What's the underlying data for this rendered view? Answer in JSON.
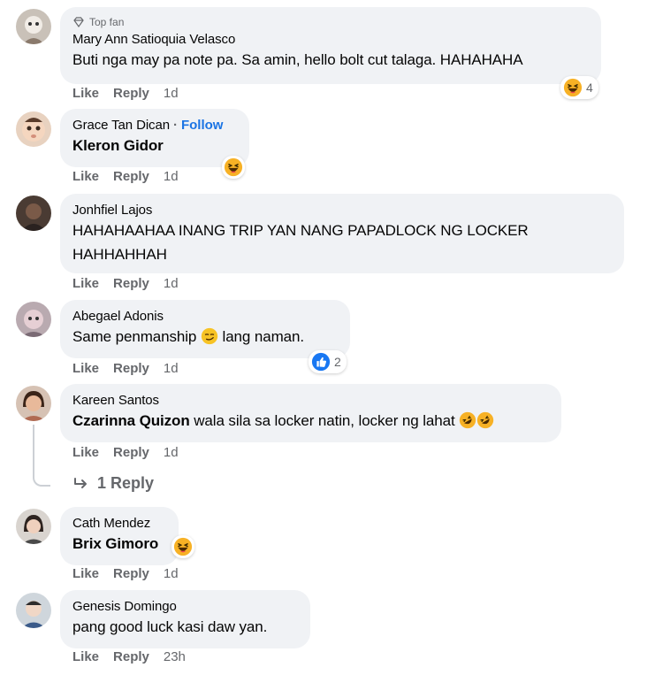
{
  "comments": [
    {
      "badge": "Top fan",
      "name": "Mary Ann Satioquia Velasco",
      "text": "Buti nga may pa note pa. Sa amin, hello bolt cut talaga. HAHAHAHA",
      "actions": {
        "like": "Like",
        "reply": "Reply",
        "time": "1d"
      },
      "reaction": {
        "icon": "haha-icon",
        "count": "4"
      }
    },
    {
      "name": "Grace Tan Dican",
      "separator": "·",
      "follow": "Follow",
      "mention": "Kleron Gidor",
      "actions": {
        "like": "Like",
        "reply": "Reply",
        "time": "1d"
      },
      "reaction": {
        "icon": "haha-icon"
      }
    },
    {
      "name": "Jonhfiel Lajos",
      "text_line1": "HAHAHAAHAA INANG TRIP YAN NANG PAPADLOCK NG LOCKER",
      "text_line2": "HAHHAHHAH",
      "actions": {
        "like": "Like",
        "reply": "Reply",
        "time": "1d"
      }
    },
    {
      "name": "Abegael Adonis",
      "text_before": "Same penmanship ",
      "text_after": " lang naman.",
      "inline_emoji": "smirk-emoji",
      "actions": {
        "like": "Like",
        "reply": "Reply",
        "time": "1d"
      },
      "reaction": {
        "icon": "like-icon",
        "count": "2"
      }
    },
    {
      "name": "Kareen Santos",
      "mention": "Czarinna Quizon",
      "text": " wala sila sa locker natin, locker ng lahat ",
      "inline_emoji": "rofl-emoji",
      "actions": {
        "like": "Like",
        "reply": "Reply",
        "time": "1d"
      },
      "replies_link": "1 Reply"
    },
    {
      "name": "Cath Mendez",
      "mention": "Brix Gimoro",
      "actions": {
        "like": "Like",
        "reply": "Reply",
        "time": "1d"
      },
      "reaction": {
        "icon": "haha-icon"
      }
    },
    {
      "name": "Genesis Domingo",
      "text": "pang good luck kasi daw yan.",
      "actions": {
        "like": "Like",
        "reply": "Reply",
        "time": "23h"
      }
    }
  ],
  "colors": {
    "bubble": "#f0f2f5",
    "link": "#1b74e4",
    "meta": "#65676b",
    "text": "#050505"
  }
}
